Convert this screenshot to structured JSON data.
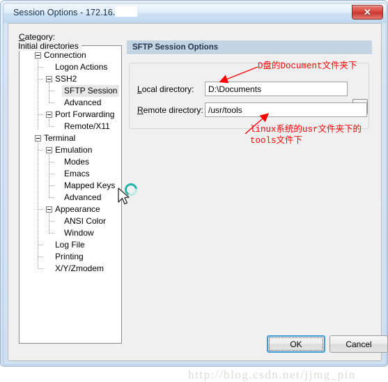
{
  "window": {
    "title": "Session Options - 172.16.1",
    "close_label": "✕",
    "close_icon": "close-icon"
  },
  "category": {
    "label_accel": "C",
    "label_rest": "ategory:"
  },
  "tree": {
    "items": [
      {
        "label": "Connection",
        "level": 0,
        "expander": true,
        "selected": false
      },
      {
        "label": "Logon Actions",
        "level": 1,
        "expander": false,
        "selected": false
      },
      {
        "label": "SSH2",
        "level": 1,
        "expander": true,
        "selected": false
      },
      {
        "label": "SFTP Session",
        "level": 2,
        "expander": false,
        "selected": true
      },
      {
        "label": "Advanced",
        "level": 2,
        "expander": false,
        "selected": false
      },
      {
        "label": "Port Forwarding",
        "level": 1,
        "expander": true,
        "selected": false
      },
      {
        "label": "Remote/X11",
        "level": 2,
        "expander": false,
        "selected": false
      },
      {
        "label": "Terminal",
        "level": 0,
        "expander": true,
        "selected": false
      },
      {
        "label": "Emulation",
        "level": 1,
        "expander": true,
        "selected": false
      },
      {
        "label": "Modes",
        "level": 2,
        "expander": false,
        "selected": false
      },
      {
        "label": "Emacs",
        "level": 2,
        "expander": false,
        "selected": false
      },
      {
        "label": "Mapped Keys",
        "level": 2,
        "expander": false,
        "selected": false
      },
      {
        "label": "Advanced",
        "level": 2,
        "expander": false,
        "selected": false
      },
      {
        "label": "Appearance",
        "level": 1,
        "expander": true,
        "selected": false
      },
      {
        "label": "ANSI Color",
        "level": 2,
        "expander": false,
        "selected": false
      },
      {
        "label": "Window",
        "level": 2,
        "expander": false,
        "selected": false
      },
      {
        "label": "Log File",
        "level": 1,
        "expander": false,
        "selected": false
      },
      {
        "label": "Printing",
        "level": 1,
        "expander": false,
        "selected": false
      },
      {
        "label": "X/Y/Zmodem",
        "level": 1,
        "expander": false,
        "selected": false
      }
    ]
  },
  "pane": {
    "header": "SFTP Session Options",
    "groupbox_title": "Initial directories",
    "local": {
      "label_accel": "L",
      "label_rest": "ocal directory:",
      "value": "D:\\Documents",
      "placeholder": ""
    },
    "remote": {
      "label_accel": "R",
      "label_rest": "emote directory:",
      "value": "/usr/tools",
      "placeholder": ""
    },
    "browse_label": "...",
    "browse_icon": "ellipsis-icon"
  },
  "annotations": [
    {
      "text": "D盘的Document文件夹下"
    },
    {
      "text": "linux系统的usr文件夹下的"
    },
    {
      "text": "tools文件下"
    }
  ],
  "buttons": {
    "ok": "OK",
    "cancel": "Cancel"
  },
  "watermark": "http://blog.csdn.net/jjmg_pin",
  "colors": {
    "accent": "#3c9bd4",
    "header_band": "#c4d3e2",
    "annotation": "#ff0000",
    "close": "#d9453c"
  }
}
